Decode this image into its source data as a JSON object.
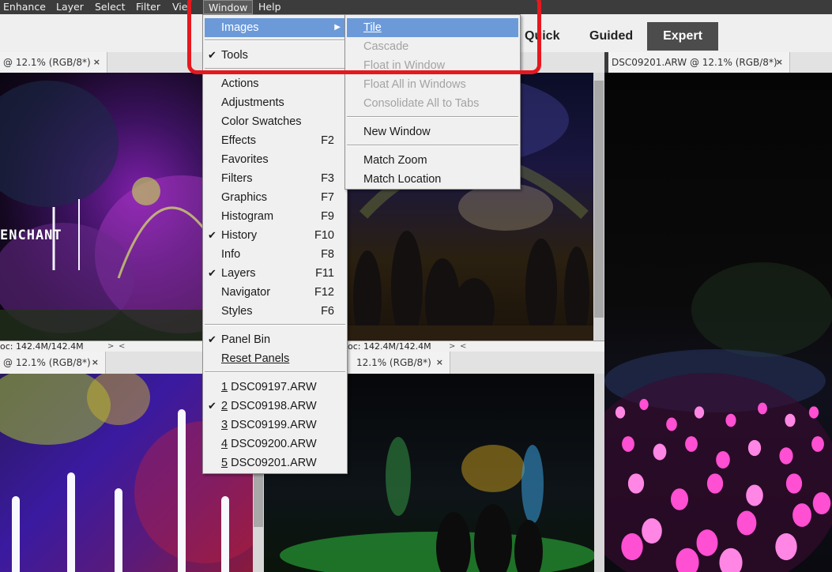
{
  "menubar": {
    "items": [
      "Enhance",
      "Layer",
      "Select",
      "Filter",
      "Vie"
    ],
    "window": "Window",
    "help": "Help"
  },
  "modes": {
    "quick": "Quick",
    "guided": "Guided",
    "expert": "Expert"
  },
  "doc_tabs": {
    "top_left": "@ 12.1% (RGB/8*)",
    "top_right": "DSC09201.ARW @ 12.1% (RGB/8*)",
    "bottom_left": "@ 12.1% (RGB/8*)",
    "bottom_mid": "12.1% (RGB/8*)",
    "close": "×"
  },
  "status": {
    "left": "oc: 142.4M/142.4M",
    "mid": "oc: 142.4M/142.4M"
  },
  "photo_text": {
    "enchant": "ENCHANT"
  },
  "window_menu": {
    "images": "Images",
    "tools": "Tools",
    "panels": [
      {
        "label": "Actions",
        "shortcut": "",
        "checked": false
      },
      {
        "label": "Adjustments",
        "shortcut": "",
        "checked": false
      },
      {
        "label": "Color Swatches",
        "shortcut": "",
        "checked": false
      },
      {
        "label": "Effects",
        "shortcut": "F2",
        "checked": false
      },
      {
        "label": "Favorites",
        "shortcut": "",
        "checked": false
      },
      {
        "label": "Filters",
        "shortcut": "F3",
        "checked": false
      },
      {
        "label": "Graphics",
        "shortcut": "F7",
        "checked": false
      },
      {
        "label": "Histogram",
        "shortcut": "F9",
        "checked": false
      },
      {
        "label": "History",
        "shortcut": "F10",
        "checked": true
      },
      {
        "label": "Info",
        "shortcut": "F8",
        "checked": false
      },
      {
        "label": "Layers",
        "shortcut": "F11",
        "checked": true
      },
      {
        "label": "Navigator",
        "shortcut": "F12",
        "checked": false
      },
      {
        "label": "Styles",
        "shortcut": "F6",
        "checked": false
      }
    ],
    "panel_bin": "Panel Bin",
    "reset_panels": "Reset Panels",
    "documents": [
      {
        "num": "1",
        "name": "DSC09197.ARW",
        "checked": false
      },
      {
        "num": "2",
        "name": "DSC09198.ARW",
        "checked": true
      },
      {
        "num": "3",
        "name": "DSC09199.ARW",
        "checked": false
      },
      {
        "num": "4",
        "name": "DSC09200.ARW",
        "checked": false
      },
      {
        "num": "5",
        "name": "DSC09201.ARW",
        "checked": false
      }
    ],
    "check_mark": "✔",
    "submenu_arrow": "▶"
  },
  "images_submenu": {
    "tile": "Tile",
    "cascade": "Cascade",
    "float_in_window": "Float in Window",
    "float_all": "Float All in Windows",
    "consolidate": "Consolidate All to Tabs",
    "new_window": "New Window",
    "match_zoom": "Match Zoom",
    "match_location": "Match Location"
  },
  "colors": {
    "highlight": "#6c9ad9",
    "annotation": "#e5181e",
    "expert_bg": "#4c4c4c"
  }
}
